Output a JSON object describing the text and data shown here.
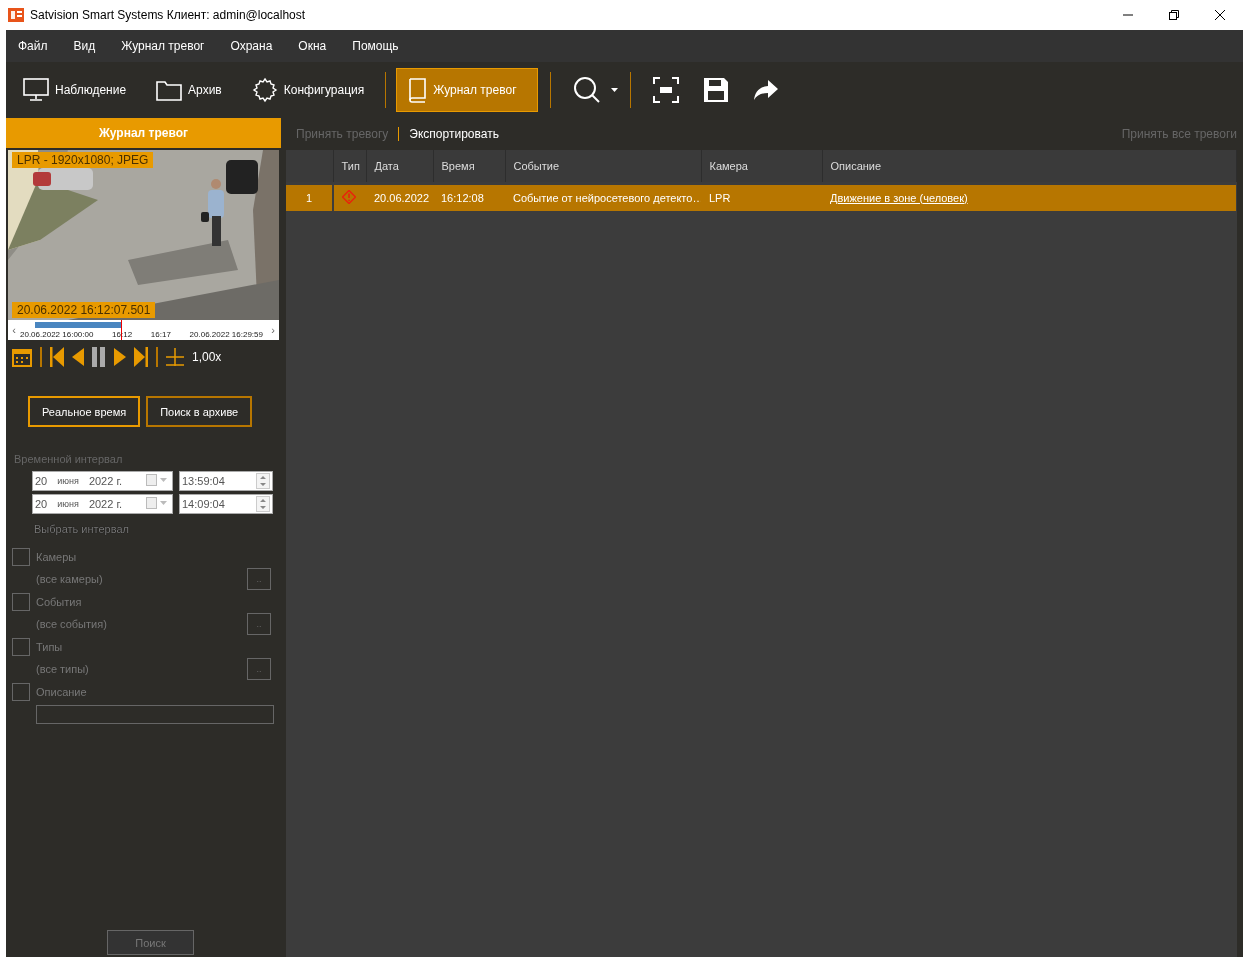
{
  "window": {
    "title": "Satvision Smart Systems Клиент: admin@localhost"
  },
  "menu": [
    "Файл",
    "Вид",
    "Журнал тревог",
    "Охрана",
    "Окна",
    "Помощь"
  ],
  "toolbar": [
    {
      "kind": "monitor",
      "label": "Наблюдение",
      "selected": false
    },
    {
      "kind": "folder",
      "label": "Архив",
      "selected": false
    },
    {
      "kind": "gear",
      "label": "Конфигурация",
      "selected": false
    },
    {
      "kind": "book",
      "label": "Журнал тревог",
      "selected": true
    }
  ],
  "left_panel": {
    "title": "Журнал тревог",
    "video": {
      "kind": "picture",
      "camera_caption": "LPR - 1920x1080; JPEG",
      "timestamp": "20.06.2022 16:12:07.501"
    },
    "timeline": {
      "prev": "‹",
      "labels": [
        "20.06.2022 16:00:00",
        "16:12",
        "16:17",
        "20.06.2022 16:29:59"
      ],
      "next": "›"
    },
    "speed": "1,00x",
    "mode_buttons": [
      {
        "label": "Реальное время",
        "selected": true
      },
      {
        "label": "Поиск в архиве",
        "selected": false
      }
    ],
    "interval_label": "Временной интервал",
    "interval": [
      {
        "day": "20",
        "month": "июня",
        "year": "2022 г.",
        "time": "13:59:04"
      },
      {
        "day": "20",
        "month": "июня",
        "year": "2022 г.",
        "time": "14:09:04"
      }
    ],
    "select_interval": "Выбрать интервал",
    "filters": [
      {
        "kind": "list",
        "label": "Камеры",
        "sub": "(все камеры)",
        "button": "..",
        "checked": false
      },
      {
        "kind": "list",
        "label": "События",
        "sub": "(все события)",
        "button": "..",
        "checked": false
      },
      {
        "kind": "list",
        "label": "Типы",
        "sub": "(все типы)",
        "button": "..",
        "checked": false
      },
      {
        "kind": "text",
        "label": "Описание",
        "checked": false
      }
    ],
    "search_button": {
      "label": "Поиск",
      "disabled": true
    }
  },
  "actions": [
    {
      "label": "Принять тревогу",
      "disabled": true
    },
    {
      "label": "Экспортировать",
      "disabled": false
    }
  ],
  "accept_all": {
    "label": "Принять все тревоги",
    "disabled": true
  },
  "table": {
    "columns": [
      "Тип",
      "Дата",
      "Время",
      "Событие",
      "Камера",
      "Описание"
    ],
    "rows": [
      {
        "number": "1",
        "date": "20.06.2022",
        "time": "16:12:08",
        "event": "Событие от нейросетевого детекто…",
        "camera": "LPR",
        "description": "Движение в зоне (человек)",
        "selected": true
      }
    ]
  }
}
